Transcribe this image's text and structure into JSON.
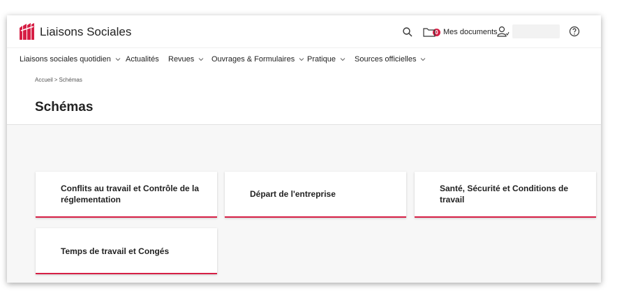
{
  "header": {
    "brand": "Liaisons Sociales",
    "documents_label": "Mes documents",
    "documents_count": "0",
    "icons": [
      "logo-icon",
      "search-icon",
      "folder-icon",
      "user-icon",
      "help-icon"
    ]
  },
  "nav": {
    "items": [
      {
        "label": "Liaisons sociales quotidien",
        "dropdown": true
      },
      {
        "label": "Actualités",
        "dropdown": false
      },
      {
        "label": "Revues",
        "dropdown": true
      },
      {
        "label": "Ouvrages & Formulaires",
        "dropdown": true
      },
      {
        "label": "Pratique",
        "dropdown": true
      },
      {
        "label": "Sources officielles",
        "dropdown": true
      }
    ]
  },
  "breadcrumb": {
    "home": "Accueil",
    "separator": ">",
    "current": "Schémas"
  },
  "page": {
    "title": "Schémas"
  },
  "cards": [
    {
      "line1": "Conflits au travail et Contrôle de la",
      "line2": "réglementation"
    },
    {
      "line1": "Départ de l'entreprise",
      "line2": ""
    },
    {
      "line1": "Santé, Sécurité et Conditions de",
      "line2": "travail"
    },
    {
      "line1": "Temps de travail et Congés",
      "line2": ""
    }
  ],
  "colors": {
    "accent": "#d61f45",
    "background": "#f7f7f7"
  }
}
